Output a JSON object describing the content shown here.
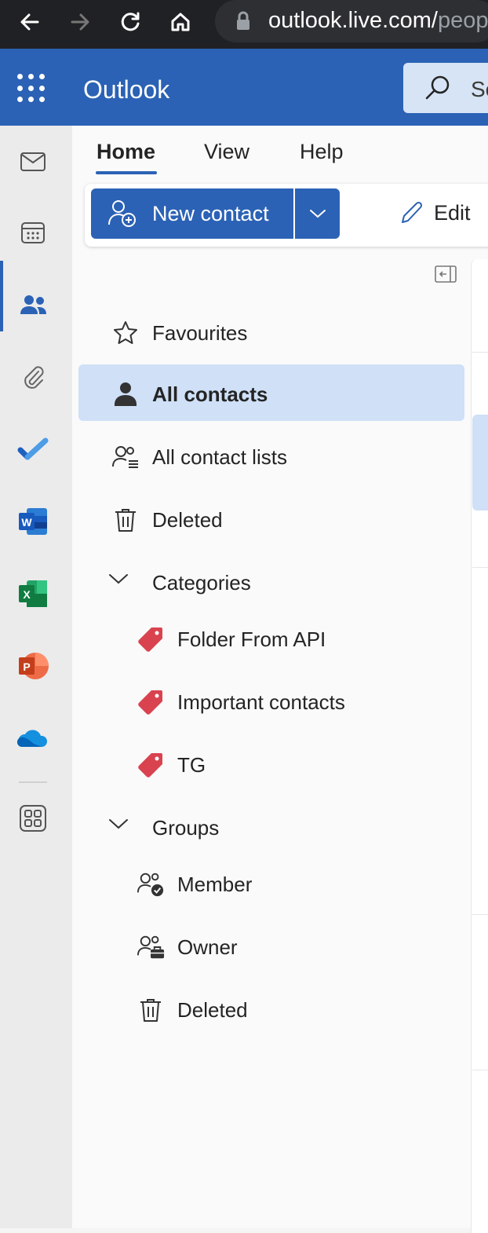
{
  "browser": {
    "url_main": "outlook.live.com/",
    "url_faded": "peop"
  },
  "header": {
    "app_title": "Outlook",
    "search_placeholder": "Se"
  },
  "ribbon": {
    "tabs": [
      {
        "label": "Home",
        "active": true
      },
      {
        "label": "View",
        "active": false
      },
      {
        "label": "Help",
        "active": false
      }
    ],
    "new_contact_label": "New contact",
    "edit_label": "Edit"
  },
  "folders": {
    "favourites": "Favourites",
    "all_contacts": "All contacts",
    "all_contact_lists": "All contact lists",
    "deleted": "Deleted",
    "categories_header": "Categories",
    "categories": [
      {
        "label": "Folder From API",
        "color": "#d9434f"
      },
      {
        "label": "Important contacts",
        "color": "#d9434f"
      },
      {
        "label": "TG",
        "color": "#d9434f"
      }
    ],
    "groups_header": "Groups",
    "groups": {
      "member": "Member",
      "owner": "Owner",
      "deleted": "Deleted"
    }
  },
  "colors": {
    "accent": "#2b62b5",
    "selected_bg": "#cfe0f7",
    "category_tag": "#d9434f"
  }
}
